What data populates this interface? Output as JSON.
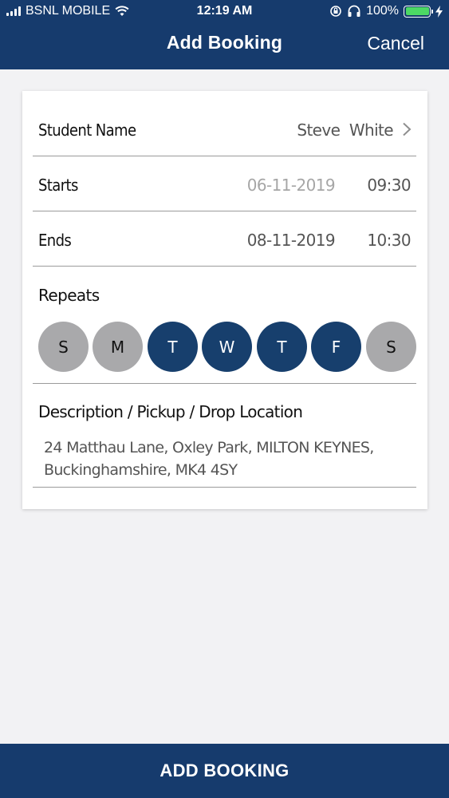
{
  "status_bar": {
    "carrier": "BSNL MOBILE",
    "time": "12:19 AM",
    "battery": "100%"
  },
  "nav": {
    "title": "Add Booking",
    "cancel_label": "Cancel"
  },
  "form": {
    "student_label": "Student Name",
    "student_value": "Steve  White",
    "starts_label": "Starts",
    "starts_date": "06-11-2019",
    "starts_time": "09:30",
    "ends_label": "Ends",
    "ends_date": "08-11-2019",
    "ends_time": "10:30",
    "repeats_label": "Repeats",
    "days": [
      {
        "label": "S",
        "selected": false
      },
      {
        "label": "M",
        "selected": false
      },
      {
        "label": "T",
        "selected": true
      },
      {
        "label": "W",
        "selected": true
      },
      {
        "label": "T",
        "selected": true
      },
      {
        "label": "F",
        "selected": true
      },
      {
        "label": "S",
        "selected": false
      }
    ],
    "description_label": "Description / Pickup / Drop Location",
    "description_value": "24 Matthau Lane, Oxley Park, MILTON KEYNES, Buckinghamshire, MK4 4SY"
  },
  "add_booking_button": "ADD BOOKING",
  "colors": {
    "brand_navy": "#163b6d",
    "day_selected": "#173f6d",
    "day_unselected": "#a9a9ab",
    "battery_green": "#4cd964"
  },
  "icons": [
    "signal-icon",
    "wifi-icon",
    "orientation-lock-icon",
    "headphones-icon",
    "battery-icon",
    "charging-bolt-icon",
    "chevron-right-icon"
  ]
}
